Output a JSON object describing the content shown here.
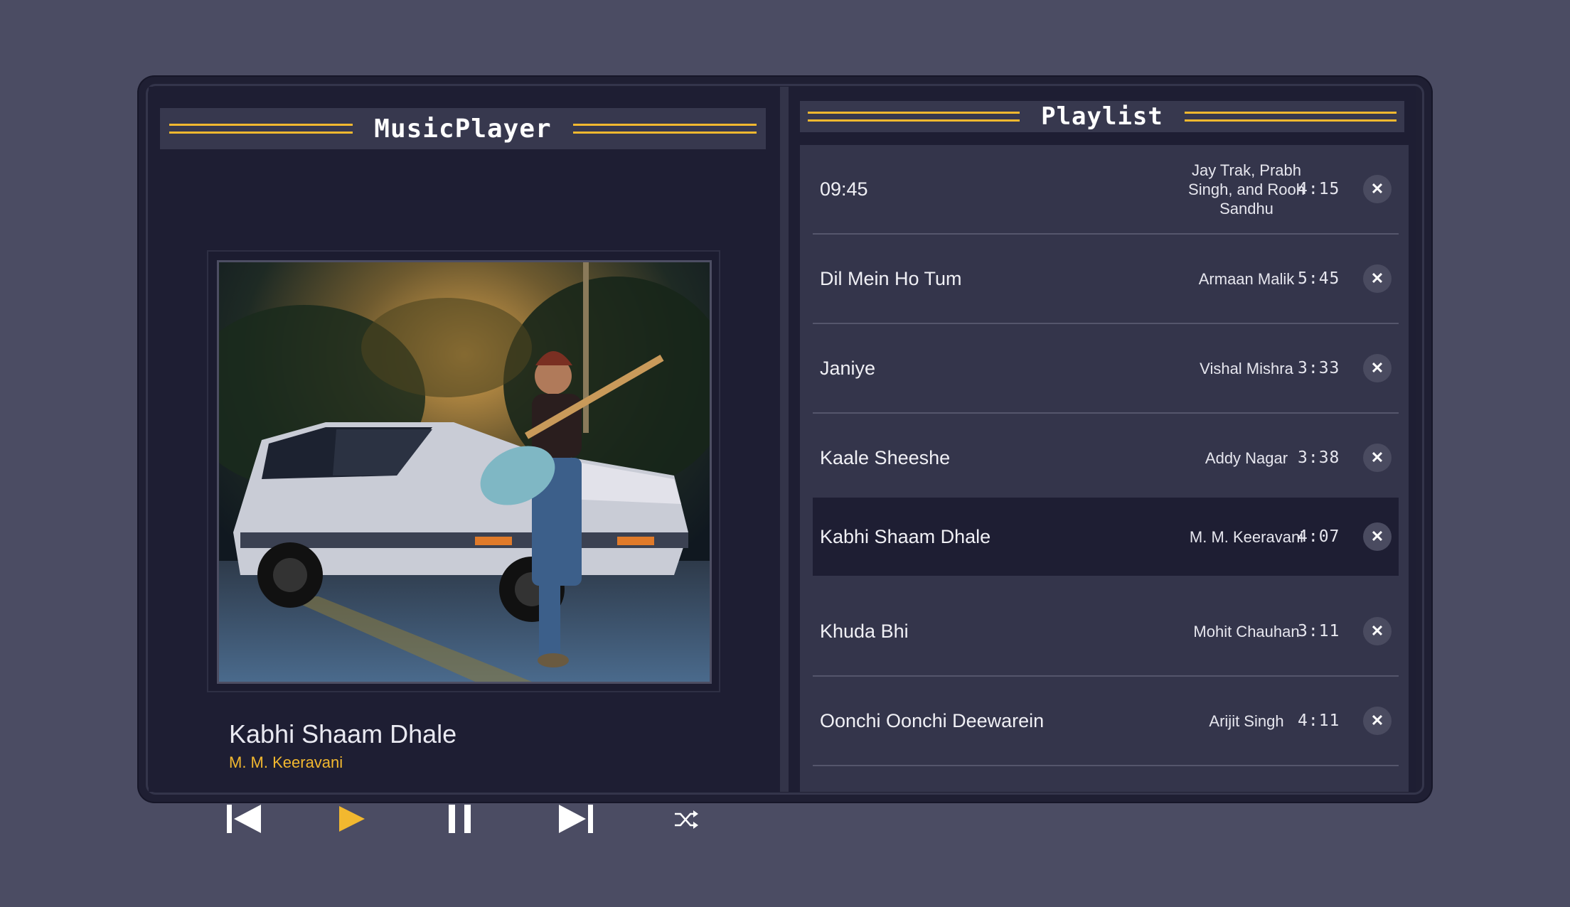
{
  "player": {
    "title": "MusicPlayer",
    "current": {
      "title": "Kabhi Shaam Dhale",
      "artist": "M. M. Keeravani"
    },
    "controls": {
      "previous_icon": "skip-previous-icon",
      "play_icon": "play-icon",
      "pause_icon": "pause-icon",
      "next_icon": "skip-next-icon",
      "shuffle_icon": "shuffle-icon"
    }
  },
  "playlist": {
    "title": "Playlist",
    "tracks": [
      {
        "name": "09:45",
        "artist": "Jay Trak, Prabh Singh, and Rooh Sandhu",
        "duration": "4:15",
        "active": false
      },
      {
        "name": "Dil Mein Ho Tum",
        "artist": "Armaan Malik",
        "duration": "5:45",
        "active": false
      },
      {
        "name": "Janiye",
        "artist": "Vishal Mishra",
        "duration": "3:33",
        "active": false
      },
      {
        "name": "Kaale Sheeshe",
        "artist": "Addy Nagar",
        "duration": "3:38",
        "active": false
      },
      {
        "name": "Kabhi Shaam Dhale",
        "artist": "M. M. Keeravani",
        "duration": "4:07",
        "active": true
      },
      {
        "name": "Khuda Bhi",
        "artist": "Mohit Chauhan",
        "duration": "3:11",
        "active": false
      },
      {
        "name": "Oonchi Oonchi Deewarein",
        "artist": "Arijit Singh",
        "duration": "4:11",
        "active": false
      }
    ]
  },
  "colors": {
    "accent": "#f2b82f",
    "background": "#4b4c63",
    "panel": "#1e1e33",
    "list": "#34354b"
  }
}
